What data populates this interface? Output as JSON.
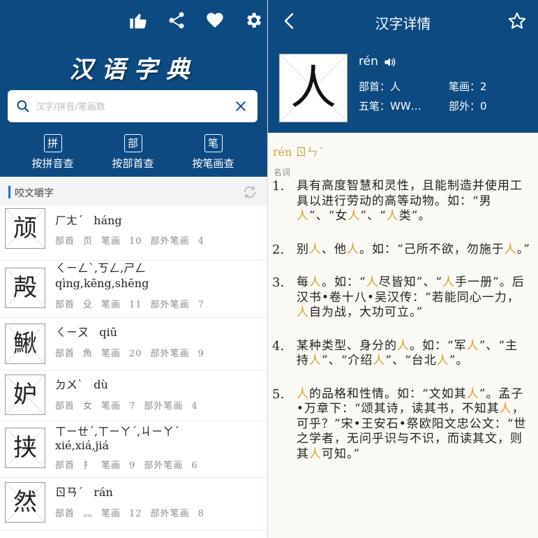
{
  "left": {
    "top_icons": [
      "thumbs-up-icon",
      "share-icon",
      "heart-icon",
      "gear-icon"
    ],
    "app_title": "汉语字典",
    "search": {
      "placeholder": "汉字/拼音/笔画数",
      "value": ""
    },
    "modes": [
      {
        "box": "拼",
        "label": "按拼音查"
      },
      {
        "box": "部",
        "label": "按部首查"
      },
      {
        "box": "笔",
        "label": "按笔画查"
      }
    ],
    "section_title": "咬文嚼字",
    "entries": [
      {
        "char": "颃",
        "zhuyin": "ㄏㄤˊ",
        "pinyin": "háng",
        "radical_label": "部首",
        "radical": "页",
        "strokes_label": "笔画",
        "strokes": "10",
        "extra_label": "部外笔画",
        "extra": "4"
      },
      {
        "char": "殸",
        "zhuyin": "ㄑㄧㄥˋ,ㄎㄥ,ㄕㄥ",
        "pinyin": "qìng,kēng,shēng",
        "radical_label": "部首",
        "radical": "殳",
        "strokes_label": "笔画",
        "strokes": "11",
        "extra_label": "部外笔画",
        "extra": "7"
      },
      {
        "char": "鰍",
        "zhuyin": "ㄑㄧㄡ",
        "pinyin": "qiū",
        "radical_label": "部首",
        "radical": "魚",
        "strokes_label": "笔画",
        "strokes": "20",
        "extra_label": "部外笔画",
        "extra": "9"
      },
      {
        "char": "妒",
        "zhuyin": "ㄉㄨˋ",
        "pinyin": "dù",
        "radical_label": "部首",
        "radical": "女",
        "strokes_label": "笔画",
        "strokes": "7",
        "extra_label": "部外笔画",
        "extra": "4"
      },
      {
        "char": "挟",
        "zhuyin": "ㄒㄧㄝˊ,ㄒㄧㄚˊ,ㄐㄧㄚˊ",
        "pinyin": "xié,xiá,jiá",
        "radical_label": "部首",
        "radical": "扌",
        "strokes_label": "笔画",
        "strokes": "9",
        "extra_label": "部外笔画",
        "extra": "6"
      },
      {
        "char": "然",
        "zhuyin": "ㄖㄢˊ",
        "pinyin": "rán",
        "radical_label": "部首",
        "radical": "灬",
        "strokes_label": "笔画",
        "strokes": "12",
        "extra_label": "部外笔画",
        "extra": "8"
      }
    ]
  },
  "right": {
    "title": "汉字详情",
    "char": "人",
    "pinyin": "rén",
    "radical": "部首：人",
    "strokes": "笔画：2",
    "wubi": "五笔：WW…",
    "extra": "部外：0",
    "pin_head": "rén ㄖㄣˊ",
    "pos": "名词",
    "definitions": [
      {
        "num": "1.",
        "text": "具有高度智慧和灵性，且能制造并使用工具以进行劳动的高等动物。如：“男[人]”、“女[人]”、“[人]类”。"
      },
      {
        "num": "2.",
        "text": "别[人]、他[人]。如：“己所不欲，勿施于[人]。”"
      },
      {
        "num": "3.",
        "text": "每[人]。如：“[人]尽皆知”、“[人]手一册”。后汉书•卷十八•吴汉传：“若能同心一力，[人]自为战，大功可立。”"
      },
      {
        "num": "4.",
        "text": "某种类型、身分的[人]。如：“军[人]”、“主持[人]”、“介绍[人]”、“台北[人]”。"
      },
      {
        "num": "5.",
        "text": "[人]的品格和性情。如：“文如其[人]”。孟子•万章下：“颂其诗，读其书，不知其[人]，可乎？”宋•王安石•祭欧阳文忠公文：“世之学者，无问乎识与不识，而读其文，则其[人]可知。”"
      }
    ]
  },
  "colors": {
    "header_blue": "#0d4a82",
    "highlight": "#d9a23a",
    "accent": "#1a6fc4"
  }
}
